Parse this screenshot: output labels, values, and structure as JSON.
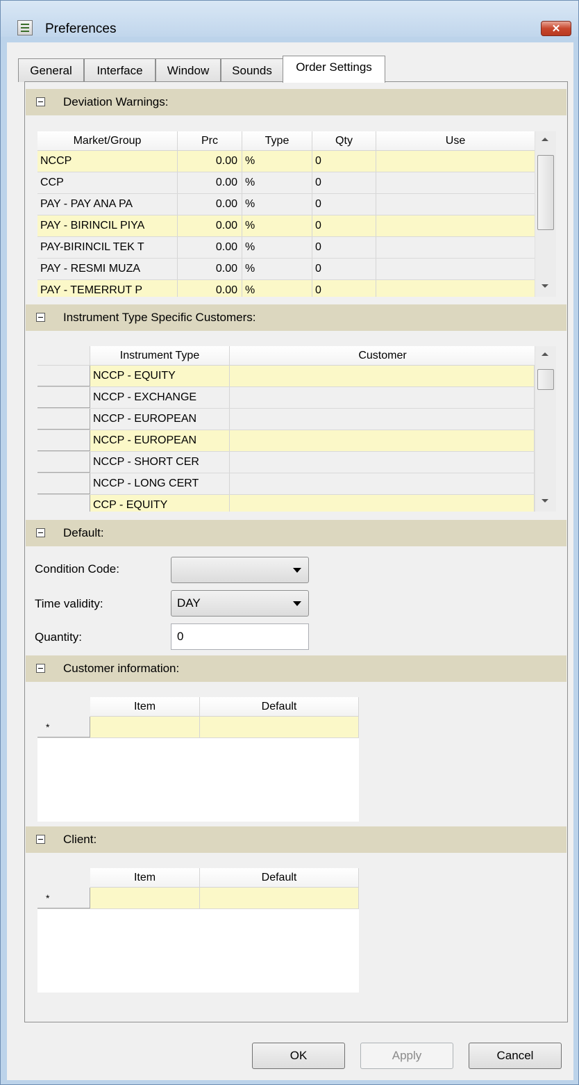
{
  "window": {
    "title": "Preferences",
    "close_label": "✕"
  },
  "tabs": [
    {
      "label": "General"
    },
    {
      "label": "Interface"
    },
    {
      "label": "Window"
    },
    {
      "label": "Sounds"
    },
    {
      "label": "Order Settings",
      "active": true
    }
  ],
  "deviation": {
    "header": "Deviation Warnings:",
    "columns": [
      "Market/Group",
      "Prc",
      "Type",
      "Qty",
      "Use"
    ],
    "rows": [
      {
        "market": "NCCP",
        "prc": "0.00",
        "type": "%",
        "qty": "0",
        "use": "",
        "highlight": true
      },
      {
        "market": "CCP",
        "prc": "0.00",
        "type": "%",
        "qty": "0",
        "use": "",
        "highlight": false
      },
      {
        "market": "PAY - PAY ANA PA",
        "prc": "0.00",
        "type": "%",
        "qty": "0",
        "use": "",
        "highlight": false
      },
      {
        "market": "PAY - BIRINCIL PIYA",
        "prc": "0.00",
        "type": "%",
        "qty": "0",
        "use": "",
        "highlight": true
      },
      {
        "market": "PAY-BIRINCIL TEK T",
        "prc": "0.00",
        "type": "%",
        "qty": "0",
        "use": "",
        "highlight": false
      },
      {
        "market": "PAY - RESMI MUZA",
        "prc": "0.00",
        "type": "%",
        "qty": "0",
        "use": "",
        "highlight": false
      },
      {
        "market": "PAY - TEMERRUT P",
        "prc": "0.00",
        "type": "%",
        "qty": "0",
        "use": "",
        "highlight": true
      }
    ]
  },
  "instrument": {
    "header": "Instrument Type Specific Customers:",
    "columns": [
      "Instrument Type",
      "Customer"
    ],
    "rows": [
      {
        "type": "NCCP - EQUITY",
        "customer": "",
        "highlight": true
      },
      {
        "type": "NCCP - EXCHANGE",
        "customer": "",
        "highlight": false
      },
      {
        "type": "NCCP - EUROPEAN",
        "customer": "",
        "highlight": false
      },
      {
        "type": "NCCP - EUROPEAN",
        "customer": "",
        "highlight": true
      },
      {
        "type": "NCCP - SHORT CER",
        "customer": "",
        "highlight": false
      },
      {
        "type": "NCCP - LONG CERT",
        "customer": "",
        "highlight": false
      },
      {
        "type": "CCP - EQUITY",
        "customer": "",
        "highlight": true
      }
    ]
  },
  "defaults": {
    "header": "Default:",
    "condition_code": {
      "label": "Condition Code:",
      "value": ""
    },
    "time_validity": {
      "label": "Time validity:",
      "value": "DAY"
    },
    "quantity": {
      "label": "Quantity:",
      "value": "0"
    }
  },
  "customer_info": {
    "header": "Customer information:",
    "columns": [
      "Item",
      "Default"
    ],
    "new_row_marker": "*"
  },
  "client": {
    "header": "Client:",
    "columns": [
      "Item",
      "Default"
    ],
    "new_row_marker": "*"
  },
  "buttons": {
    "ok": "OK",
    "apply": "Apply",
    "cancel": "Cancel"
  },
  "colors": {
    "row_highlight": "#fbf8c8",
    "section_header": "#dcd7bf",
    "window_frame": "#bcd3ea"
  }
}
